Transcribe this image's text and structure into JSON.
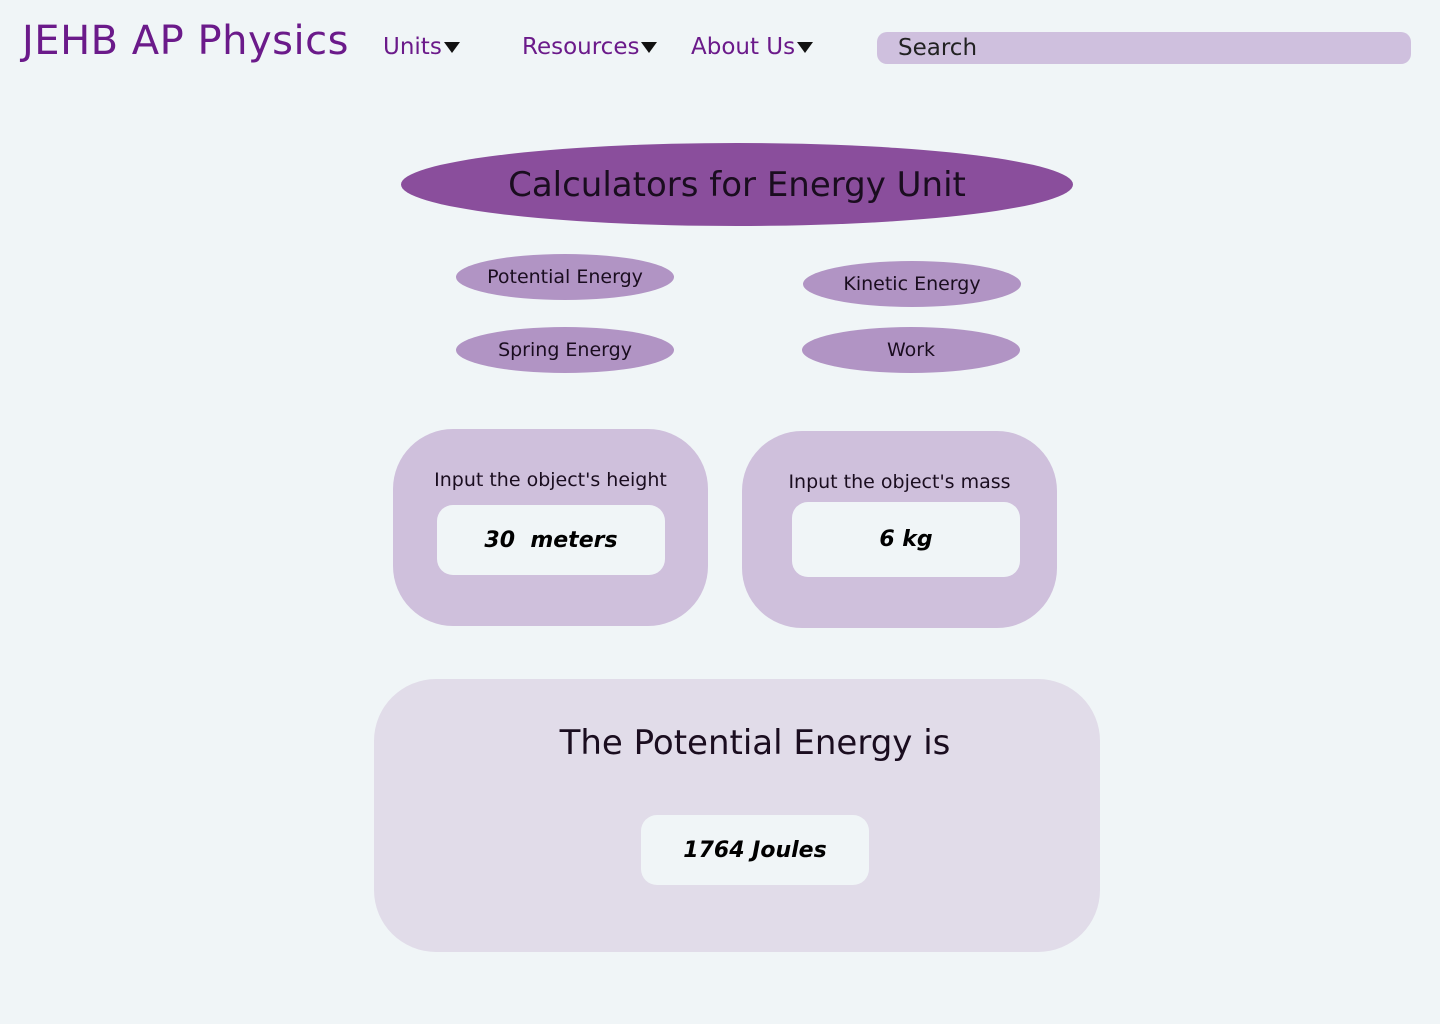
{
  "header": {
    "brand": "JEHB AP Physics",
    "nav": [
      {
        "label": "Units",
        "icon": "caret-down-icon"
      },
      {
        "label": "Resources",
        "icon": "caret-down-icon"
      },
      {
        "label": "About Us",
        "icon": "caret-down-icon"
      }
    ],
    "search_placeholder": "Search"
  },
  "main": {
    "title": "Calculators for Energy Unit",
    "calculators": [
      {
        "label": "Potential Energy"
      },
      {
        "label": "Kinetic Energy"
      },
      {
        "label": "Spring Energy"
      },
      {
        "label": "Work"
      }
    ],
    "inputs": {
      "height": {
        "label": "Input the object's height",
        "value": "30  meters"
      },
      "mass": {
        "label": "Input the object's mass",
        "value": "6 kg"
      }
    },
    "result": {
      "label": "The Potential Energy is",
      "value": "1764 Joules"
    }
  },
  "colors": {
    "background": "#f0f5f7",
    "brand": "#6b1a8a",
    "title_ellipse": "#8a4e9c",
    "pill": "#b194c4",
    "card": "#cfc0dc",
    "result_panel": "#e1dce9",
    "search": "#cfc0de"
  }
}
